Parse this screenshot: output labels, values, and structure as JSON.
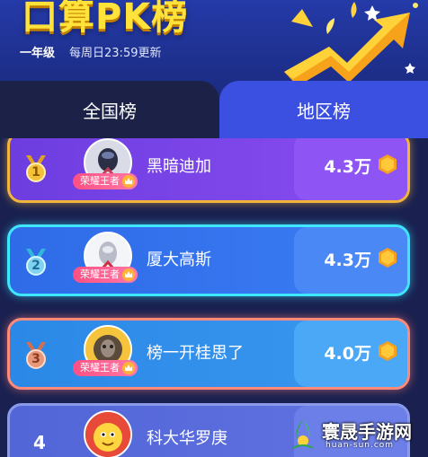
{
  "header": {
    "title": "口算PK榜",
    "grade": "一年级",
    "update_time": "每周日23:59更新"
  },
  "tabs": [
    {
      "label": "全国榜",
      "active": true
    },
    {
      "label": "地区榜",
      "active": false
    }
  ],
  "ranking": [
    {
      "rank": "1",
      "name": "黑暗迪加",
      "badge": "荣耀王者",
      "score": "4.3万",
      "medal": "gold"
    },
    {
      "rank": "2",
      "name": "厦大高斯",
      "badge": "荣耀王者",
      "score": "4.3万",
      "medal": "silver"
    },
    {
      "rank": "3",
      "name": "榜一开桂思了",
      "badge": "荣耀王者",
      "score": "4.0万",
      "medal": "bronze"
    },
    {
      "rank": "4",
      "name": "科大华罗庚",
      "badge": "",
      "score": "",
      "medal": "none"
    }
  ],
  "colors": {
    "title_yellow": "#ffe23a",
    "gold_border": "#f2b43a",
    "silver_border": "#3fe6ff",
    "bronze_border": "#ff8a78",
    "badge_pink": "#ff4f84",
    "tab_active": "#1b2147",
    "tab_inactive": "#3b4fe0"
  },
  "icons": {
    "medal": "medal-icon",
    "coin": "hexagon-coin-icon",
    "crown": "crown-icon",
    "rising_arrow": "rising-arrow-graphic"
  },
  "watermark": {
    "text": "寰晟手游网",
    "url": "huan-sun.com"
  }
}
